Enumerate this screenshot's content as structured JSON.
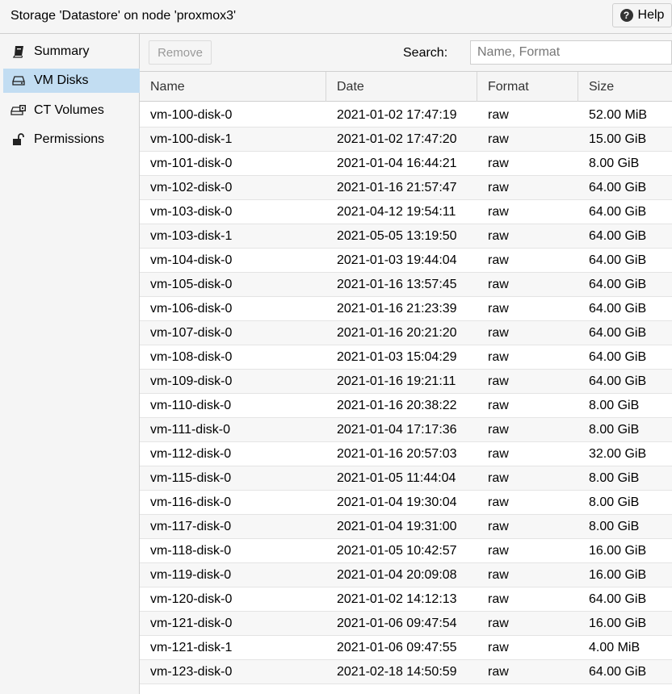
{
  "window": {
    "title": "Storage 'Datastore' on node 'proxmox3'",
    "help_label": "Help"
  },
  "sidebar": {
    "items": [
      {
        "label": "Summary",
        "icon": "book-icon",
        "active": false
      },
      {
        "label": "VM Disks",
        "icon": "hdd-icon",
        "active": true
      },
      {
        "label": "CT Volumes",
        "icon": "ct-volumes-icon",
        "active": false
      },
      {
        "label": "Permissions",
        "icon": "unlock-icon",
        "active": false
      }
    ]
  },
  "toolbar": {
    "remove_label": "Remove",
    "search_label": "Search:",
    "search_placeholder": "Name, Format",
    "search_value": ""
  },
  "table": {
    "columns": [
      "Name",
      "Date",
      "Format",
      "Size"
    ],
    "rows": [
      [
        "vm-100-disk-0",
        "2021-01-02 17:47:19",
        "raw",
        "52.00 MiB"
      ],
      [
        "vm-100-disk-1",
        "2021-01-02 17:47:20",
        "raw",
        "15.00 GiB"
      ],
      [
        "vm-101-disk-0",
        "2021-01-04 16:44:21",
        "raw",
        "8.00 GiB"
      ],
      [
        "vm-102-disk-0",
        "2021-01-16 21:57:47",
        "raw",
        "64.00 GiB"
      ],
      [
        "vm-103-disk-0",
        "2021-04-12 19:54:11",
        "raw",
        "64.00 GiB"
      ],
      [
        "vm-103-disk-1",
        "2021-05-05 13:19:50",
        "raw",
        "64.00 GiB"
      ],
      [
        "vm-104-disk-0",
        "2021-01-03 19:44:04",
        "raw",
        "64.00 GiB"
      ],
      [
        "vm-105-disk-0",
        "2021-01-16 13:57:45",
        "raw",
        "64.00 GiB"
      ],
      [
        "vm-106-disk-0",
        "2021-01-16 21:23:39",
        "raw",
        "64.00 GiB"
      ],
      [
        "vm-107-disk-0",
        "2021-01-16 20:21:20",
        "raw",
        "64.00 GiB"
      ],
      [
        "vm-108-disk-0",
        "2021-01-03 15:04:29",
        "raw",
        "64.00 GiB"
      ],
      [
        "vm-109-disk-0",
        "2021-01-16 19:21:11",
        "raw",
        "64.00 GiB"
      ],
      [
        "vm-110-disk-0",
        "2021-01-16 20:38:22",
        "raw",
        "8.00 GiB"
      ],
      [
        "vm-111-disk-0",
        "2021-01-04 17:17:36",
        "raw",
        "8.00 GiB"
      ],
      [
        "vm-112-disk-0",
        "2021-01-16 20:57:03",
        "raw",
        "32.00 GiB"
      ],
      [
        "vm-115-disk-0",
        "2021-01-05 11:44:04",
        "raw",
        "8.00 GiB"
      ],
      [
        "vm-116-disk-0",
        "2021-01-04 19:30:04",
        "raw",
        "8.00 GiB"
      ],
      [
        "vm-117-disk-0",
        "2021-01-04 19:31:00",
        "raw",
        "8.00 GiB"
      ],
      [
        "vm-118-disk-0",
        "2021-01-05 10:42:57",
        "raw",
        "16.00 GiB"
      ],
      [
        "vm-119-disk-0",
        "2021-01-04 20:09:08",
        "raw",
        "16.00 GiB"
      ],
      [
        "vm-120-disk-0",
        "2021-01-02 14:12:13",
        "raw",
        "64.00 GiB"
      ],
      [
        "vm-121-disk-0",
        "2021-01-06 09:47:54",
        "raw",
        "16.00 GiB"
      ],
      [
        "vm-121-disk-1",
        "2021-01-06 09:47:55",
        "raw",
        "4.00 MiB"
      ],
      [
        "vm-123-disk-0",
        "2021-02-18 14:50:59",
        "raw",
        "64.00 GiB"
      ]
    ]
  }
}
